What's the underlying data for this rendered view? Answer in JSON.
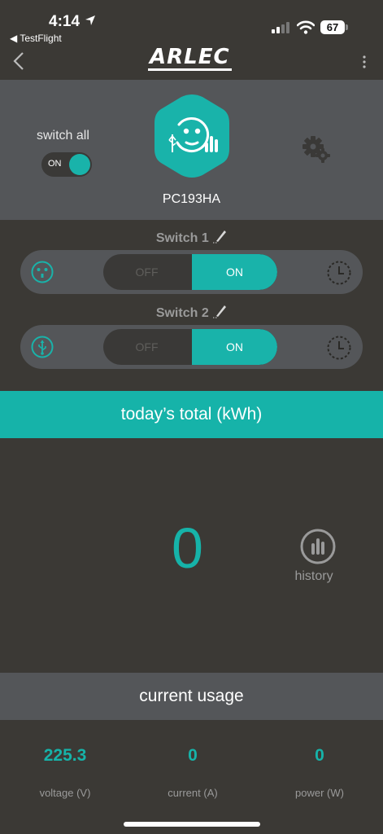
{
  "status": {
    "time": "4:14",
    "back_app": "◀ TestFlight",
    "battery": "67"
  },
  "nav": {
    "logo": "ARLEC"
  },
  "device": {
    "switch_all_label": "switch all",
    "master_state": "ON",
    "name": "PC193HA"
  },
  "switches": [
    {
      "label": "Switch 1",
      "off_label": "OFF",
      "on_label": "ON",
      "state": "ON"
    },
    {
      "label": "Switch 2",
      "off_label": "OFF",
      "on_label": "ON",
      "state": "ON"
    }
  ],
  "energy": {
    "today_title": "today’s total (kWh)",
    "today_value": "0",
    "history_label": "history"
  },
  "usage": {
    "title": "current usage",
    "metrics": [
      {
        "value": "225.3",
        "label": "voltage (V)"
      },
      {
        "value": "0",
        "label": "current (A)"
      },
      {
        "value": "0",
        "label": "power (W)"
      }
    ]
  },
  "colors": {
    "accent": "#16b3a9",
    "background": "#3b3935",
    "panel": "#545659"
  },
  "icons": {
    "device": "smart-plug-icon",
    "outlet": "power-outlet-icon",
    "usb": "usb-icon",
    "timer": "timer-icon",
    "settings": "gear-icon",
    "history": "bar-chart-icon"
  }
}
